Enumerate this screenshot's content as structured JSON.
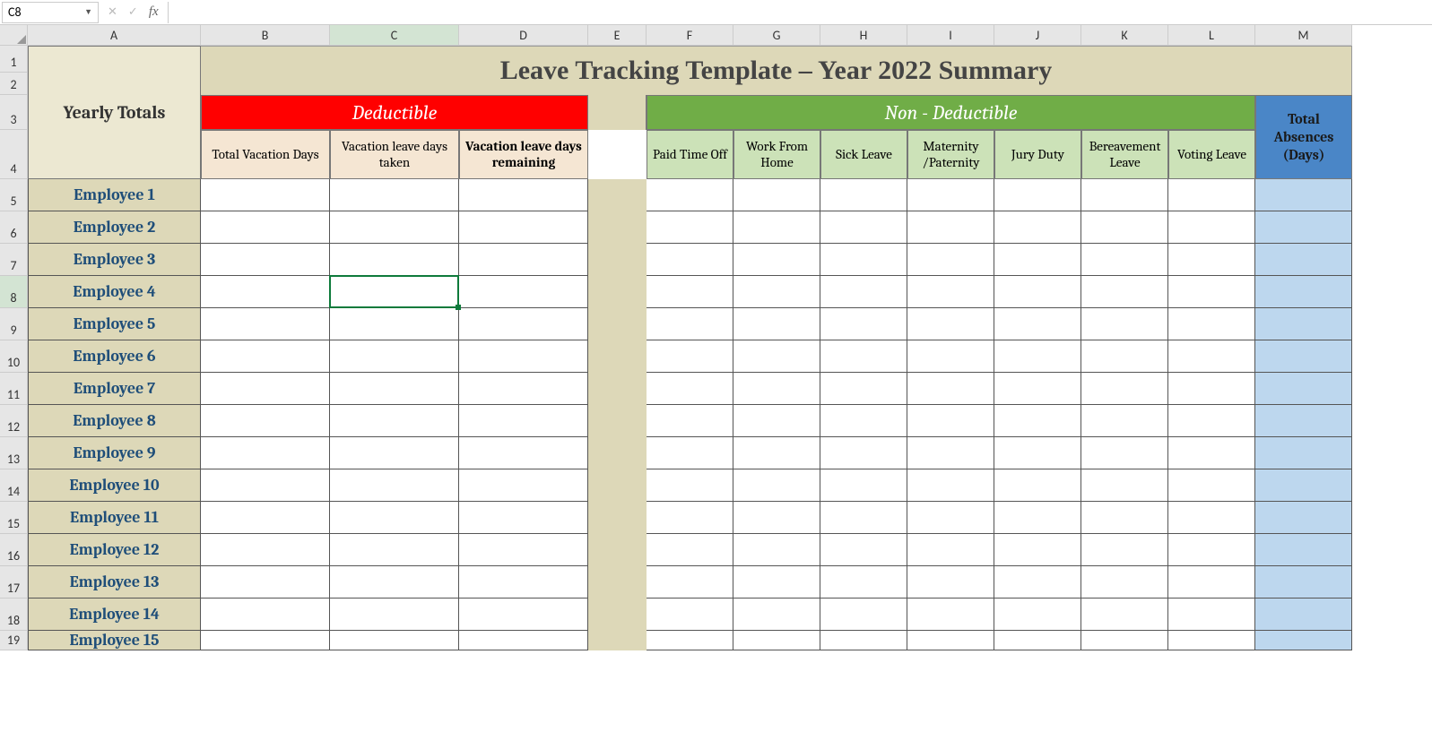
{
  "name_box": "C8",
  "formula": "",
  "title": "Leave Tracking Template – Year 2022 Summary",
  "yearly_totals_label": "Yearly Totals",
  "deductible_label": "Deductible",
  "non_deductible_label": "Non - Deductible",
  "total_absences_label_l1": "Total",
  "total_absences_label_l2": "Absences",
  "total_absences_label_l3": "(Days)",
  "columns": [
    "A",
    "B",
    "C",
    "D",
    "E",
    "F",
    "G",
    "H",
    "I",
    "J",
    "K",
    "L",
    "M"
  ],
  "selected_col": "C",
  "selected_row": "8",
  "deductible_headers": {
    "b": "Total Vacation Days",
    "c": "Vacation leave days taken",
    "d": "Vacation leave days remaining"
  },
  "non_deductible_headers": {
    "f": "Paid Time Off",
    "g": "Work From Home",
    "h": "Sick Leave",
    "i": "Maternity /Paternity",
    "j": "Jury Duty",
    "k": "Bereavement Leave",
    "l": "Voting Leave"
  },
  "employees": [
    "Employee 1",
    "Employee 2",
    "Employee 3",
    "Employee 4",
    "Employee 5",
    "Employee 6",
    "Employee 7",
    "Employee 8",
    "Employee 9",
    "Employee 10",
    "Employee 11",
    "Employee 12",
    "Employee 13",
    "Employee 14",
    "Employee 15"
  ],
  "chart_data": {
    "type": "table",
    "title": "Leave Tracking Template – Year 2022 Summary",
    "row_header": "Yearly Totals",
    "columns": [
      {
        "group": "Deductible",
        "name": "Total Vacation Days"
      },
      {
        "group": "Deductible",
        "name": "Vacation leave days taken"
      },
      {
        "group": "Deductible",
        "name": "Vacation leave days remaining"
      },
      {
        "group": "Non - Deductible",
        "name": "Paid Time Off"
      },
      {
        "group": "Non - Deductible",
        "name": "Work From Home"
      },
      {
        "group": "Non - Deductible",
        "name": "Sick Leave"
      },
      {
        "group": "Non - Deductible",
        "name": "Maternity /Paternity"
      },
      {
        "group": "Non - Deductible",
        "name": "Jury Duty"
      },
      {
        "group": "Non - Deductible",
        "name": "Bereavement Leave"
      },
      {
        "group": "Non - Deductible",
        "name": "Voting Leave"
      },
      {
        "group": "Total",
        "name": "Total Absences (Days)"
      }
    ],
    "rows": [
      {
        "employee": "Employee 1",
        "values": [
          null,
          null,
          null,
          null,
          null,
          null,
          null,
          null,
          null,
          null,
          null
        ]
      },
      {
        "employee": "Employee 2",
        "values": [
          null,
          null,
          null,
          null,
          null,
          null,
          null,
          null,
          null,
          null,
          null
        ]
      },
      {
        "employee": "Employee 3",
        "values": [
          null,
          null,
          null,
          null,
          null,
          null,
          null,
          null,
          null,
          null,
          null
        ]
      },
      {
        "employee": "Employee 4",
        "values": [
          null,
          null,
          null,
          null,
          null,
          null,
          null,
          null,
          null,
          null,
          null
        ]
      },
      {
        "employee": "Employee 5",
        "values": [
          null,
          null,
          null,
          null,
          null,
          null,
          null,
          null,
          null,
          null,
          null
        ]
      },
      {
        "employee": "Employee 6",
        "values": [
          null,
          null,
          null,
          null,
          null,
          null,
          null,
          null,
          null,
          null,
          null
        ]
      },
      {
        "employee": "Employee 7",
        "values": [
          null,
          null,
          null,
          null,
          null,
          null,
          null,
          null,
          null,
          null,
          null
        ]
      },
      {
        "employee": "Employee 8",
        "values": [
          null,
          null,
          null,
          null,
          null,
          null,
          null,
          null,
          null,
          null,
          null
        ]
      },
      {
        "employee": "Employee 9",
        "values": [
          null,
          null,
          null,
          null,
          null,
          null,
          null,
          null,
          null,
          null,
          null
        ]
      },
      {
        "employee": "Employee 10",
        "values": [
          null,
          null,
          null,
          null,
          null,
          null,
          null,
          null,
          null,
          null,
          null
        ]
      },
      {
        "employee": "Employee 11",
        "values": [
          null,
          null,
          null,
          null,
          null,
          null,
          null,
          null,
          null,
          null,
          null
        ]
      },
      {
        "employee": "Employee 12",
        "values": [
          null,
          null,
          null,
          null,
          null,
          null,
          null,
          null,
          null,
          null,
          null
        ]
      },
      {
        "employee": "Employee 13",
        "values": [
          null,
          null,
          null,
          null,
          null,
          null,
          null,
          null,
          null,
          null,
          null
        ]
      },
      {
        "employee": "Employee 14",
        "values": [
          null,
          null,
          null,
          null,
          null,
          null,
          null,
          null,
          null,
          null,
          null
        ]
      },
      {
        "employee": "Employee 15",
        "values": [
          null,
          null,
          null,
          null,
          null,
          null,
          null,
          null,
          null,
          null,
          null
        ]
      }
    ]
  }
}
